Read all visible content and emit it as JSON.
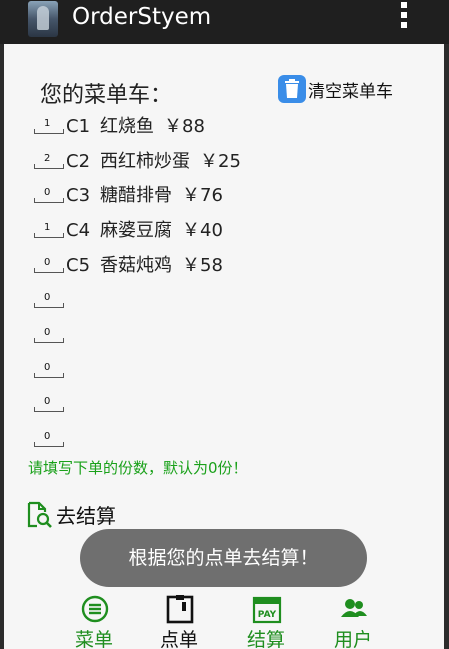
{
  "app": {
    "title": "OrderStyem",
    "icon": "app-photo-icon"
  },
  "cart": {
    "title": "您的菜单车：",
    "clear_label": "清空菜单车",
    "items": [
      {
        "qty": "1",
        "code": "C1",
        "name": "红烧鱼",
        "price": "￥88"
      },
      {
        "qty": "2",
        "code": "C2",
        "name": "西红柿炒蛋",
        "price": "￥25"
      },
      {
        "qty": "0",
        "code": "C3",
        "name": "糖醋排骨",
        "price": "￥76"
      },
      {
        "qty": "1",
        "code": "C4",
        "name": "麻婆豆腐",
        "price": "￥40"
      },
      {
        "qty": "0",
        "code": "C5",
        "name": "香菇炖鸡",
        "price": "￥58"
      }
    ],
    "extra_qty": [
      "0",
      "0",
      "0",
      "0",
      "0"
    ],
    "hint": "请填写下单的份数，默认为0份！",
    "checkout_label": "去结算"
  },
  "toast": "根据您的点单去结算！",
  "tabs": [
    {
      "label": "菜单",
      "icon": "menu-list-icon",
      "active": false
    },
    {
      "label": "点单",
      "icon": "order-clipboard-icon",
      "active": true
    },
    {
      "label": "结算",
      "icon": "pay-calendar-icon",
      "active": false
    },
    {
      "label": "用户",
      "icon": "users-icon",
      "active": false
    }
  ],
  "colors": {
    "accent_green": "#1f8e1f",
    "action_bar": "#1f1f1f",
    "trash_blue": "#3a8de8",
    "toast_gray": "#6f6f6f"
  }
}
